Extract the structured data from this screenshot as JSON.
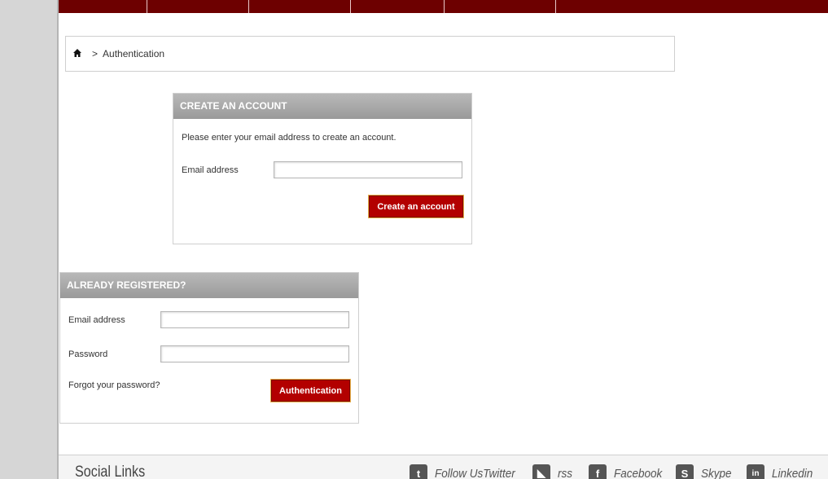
{
  "breadcrumb": {
    "separator": ">",
    "current": "Authentication"
  },
  "create_account": {
    "title": "CREATE AN ACCOUNT",
    "instruction": "Please enter your email address to create an account.",
    "email_label": "Email address",
    "email_value": "",
    "submit_label": "Create an account"
  },
  "login": {
    "title": "ALREADY REGISTERED?",
    "email_label": "Email address",
    "email_value": "",
    "password_label": "Password",
    "password_value": "",
    "forgot_label": "Forgot your password?",
    "submit_label": "Authentication"
  },
  "footer": {
    "title": "Social Links",
    "links": [
      {
        "icon": "twitter-icon",
        "glyph": "t",
        "label": "Follow UsTwitter"
      },
      {
        "icon": "rss-icon",
        "glyph": "◣",
        "label": "rss"
      },
      {
        "icon": "facebook-icon",
        "glyph": "f",
        "label": "Facebook"
      },
      {
        "icon": "skype-icon",
        "glyph": "S",
        "label": "Skype"
      },
      {
        "icon": "linkedin-icon",
        "glyph": "in",
        "label": "Linkedin"
      }
    ]
  },
  "colors": {
    "nav_bg": "#6d0000",
    "button_bg": "#b30000",
    "header_gray": "#a8a8a8"
  }
}
